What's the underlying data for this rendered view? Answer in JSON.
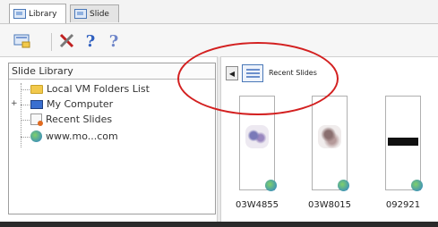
{
  "tabs": [
    {
      "label": "Library",
      "active": true
    },
    {
      "label": "Slide",
      "active": false
    }
  ],
  "toolbar": {
    "icons": [
      "library-settings-icon",
      "tools-icon",
      "help-icon",
      "context-help-icon"
    ],
    "help_glyph": "?",
    "context_help_glyph": "?"
  },
  "left_panel": {
    "title": "Slide Library",
    "items": [
      {
        "label": "Local VM Folders List",
        "icon": "folder-icon"
      },
      {
        "label": "My Computer",
        "icon": "computer-icon",
        "expandable": true
      },
      {
        "label": "Recent Slides",
        "icon": "recent-slides-icon"
      },
      {
        "label": "www.mo...com",
        "icon": "globe-icon"
      }
    ],
    "expander_glyph": "+"
  },
  "right_panel": {
    "title": "Recent Slides",
    "back_glyph": "◀",
    "thumbnails": [
      {
        "caption": "03W4855"
      },
      {
        "caption": "03W8015"
      },
      {
        "caption": "092921"
      }
    ]
  },
  "annotation": {
    "color": "#d32020",
    "shape": "ellipse"
  }
}
